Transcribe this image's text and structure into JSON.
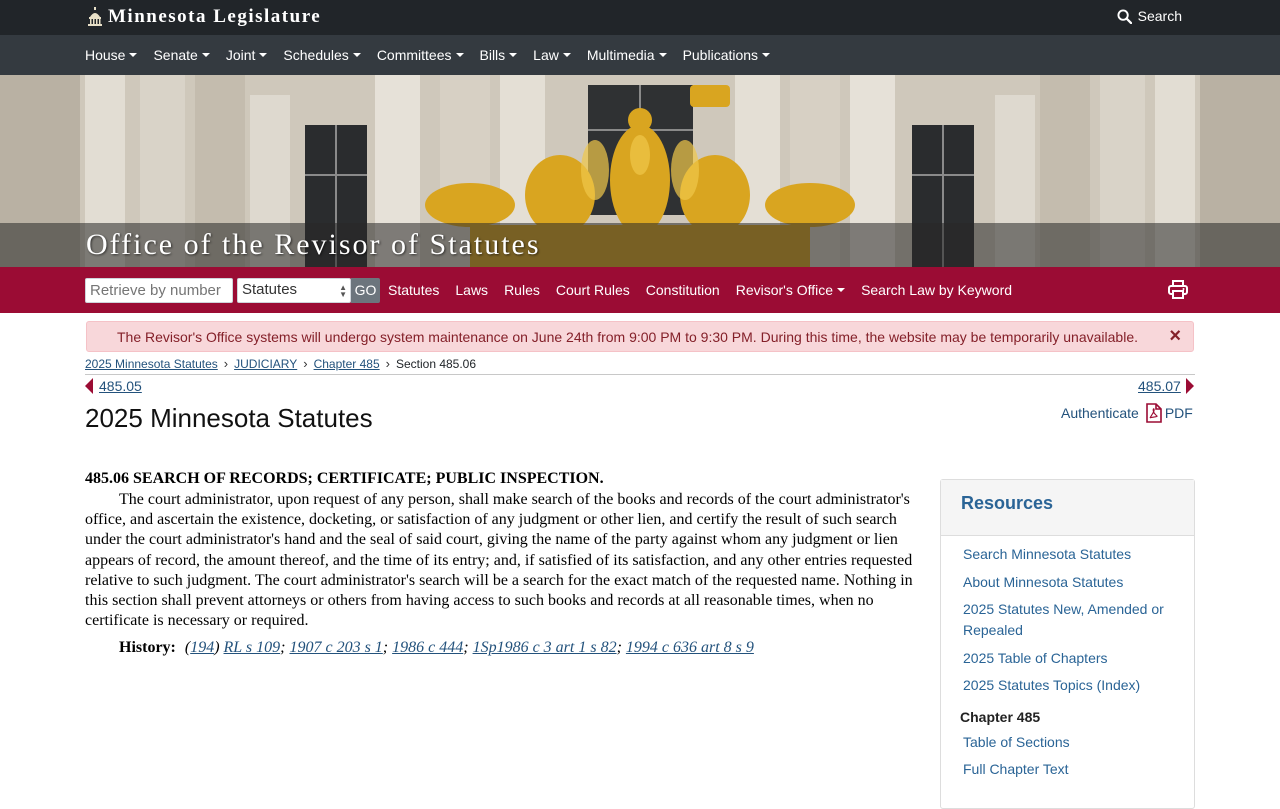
{
  "topbar": {
    "brand": "Minnesota Legislature",
    "search_label": "Search"
  },
  "main_nav": [
    {
      "label": "House"
    },
    {
      "label": "Senate"
    },
    {
      "label": "Joint"
    },
    {
      "label": "Schedules"
    },
    {
      "label": "Committees"
    },
    {
      "label": "Bills"
    },
    {
      "label": "Law"
    },
    {
      "label": "Multimedia"
    },
    {
      "label": "Publications"
    }
  ],
  "hero": {
    "title": "Office of the Revisor of Statutes"
  },
  "sub_nav": {
    "retrieve_placeholder": "Retrieve by number",
    "select_value": "Statutes",
    "go_label": "GO",
    "links": [
      "Statutes",
      "Laws",
      "Rules",
      "Court Rules",
      "Constitution",
      "Revisor's Office",
      "Search Law by Keyword"
    ]
  },
  "alert": {
    "message": "The Revisor's Office systems will undergo system maintenance on June 24th from 9:00 PM to 9:30 PM. During this time, the website may be temporarily unavailable.",
    "close": "×"
  },
  "breadcrumb": {
    "items": [
      "2025 Minnesota Statutes",
      "JUDICIARY",
      "Chapter 485"
    ],
    "current": "Section 485.06"
  },
  "pager": {
    "prev": "485.05",
    "next": "485.07"
  },
  "page_title": "2025 Minnesota Statutes",
  "doc_links": {
    "authenticate": "Authenticate",
    "pdf": "PDF"
  },
  "statute": {
    "heading": "485.06 SEARCH OF RECORDS; CERTIFICATE; PUBLIC INSPECTION.",
    "body": "The court administrator, upon request of any person, shall make search of the books and records of the court administrator's office, and ascertain the existence, docketing, or satisfaction of any judgment or other lien, and certify the result of such search under the court administrator's hand and the seal of said court, giving the name of the party against whom any judgment or lien appears of record, the amount thereof, and the time of its entry; and, if satisfied of its satisfaction, and any other entries requested relative to such judgment. The court administrator's search will be a search for the exact match of the requested name. Nothing in this section shall prevent attorneys or others from having access to such books and records at all reasonable times, when no certificate is necessary or required.",
    "history_label": "History:",
    "history": [
      "194",
      "RL s 109",
      "1907 c 203 s 1",
      "1986 c 444",
      "1Sp1986 c 3 art 1 s 82",
      "1994 c 636 art 8 s 9"
    ]
  },
  "resources": {
    "title": "Resources",
    "links": [
      "Search Minnesota Statutes",
      "About Minnesota Statutes",
      "2025 Statutes New, Amended or Repealed",
      "2025 Table of Chapters",
      "2025 Statutes Topics (Index)"
    ],
    "chapter_heading": "Chapter 485",
    "chapter_links": [
      "Table of Sections",
      "Full Chapter Text"
    ]
  },
  "colors": {
    "brand_red": "#9b0c34",
    "topbar": "#212529",
    "nav": "#343a40",
    "link": "#23527c",
    "alert_bg": "#f8d7da"
  },
  "icons": [
    "capitol-dome-icon",
    "search-icon",
    "print-icon",
    "pdf-icon",
    "chevron-left-icon",
    "chevron-right-icon",
    "close-icon"
  ]
}
